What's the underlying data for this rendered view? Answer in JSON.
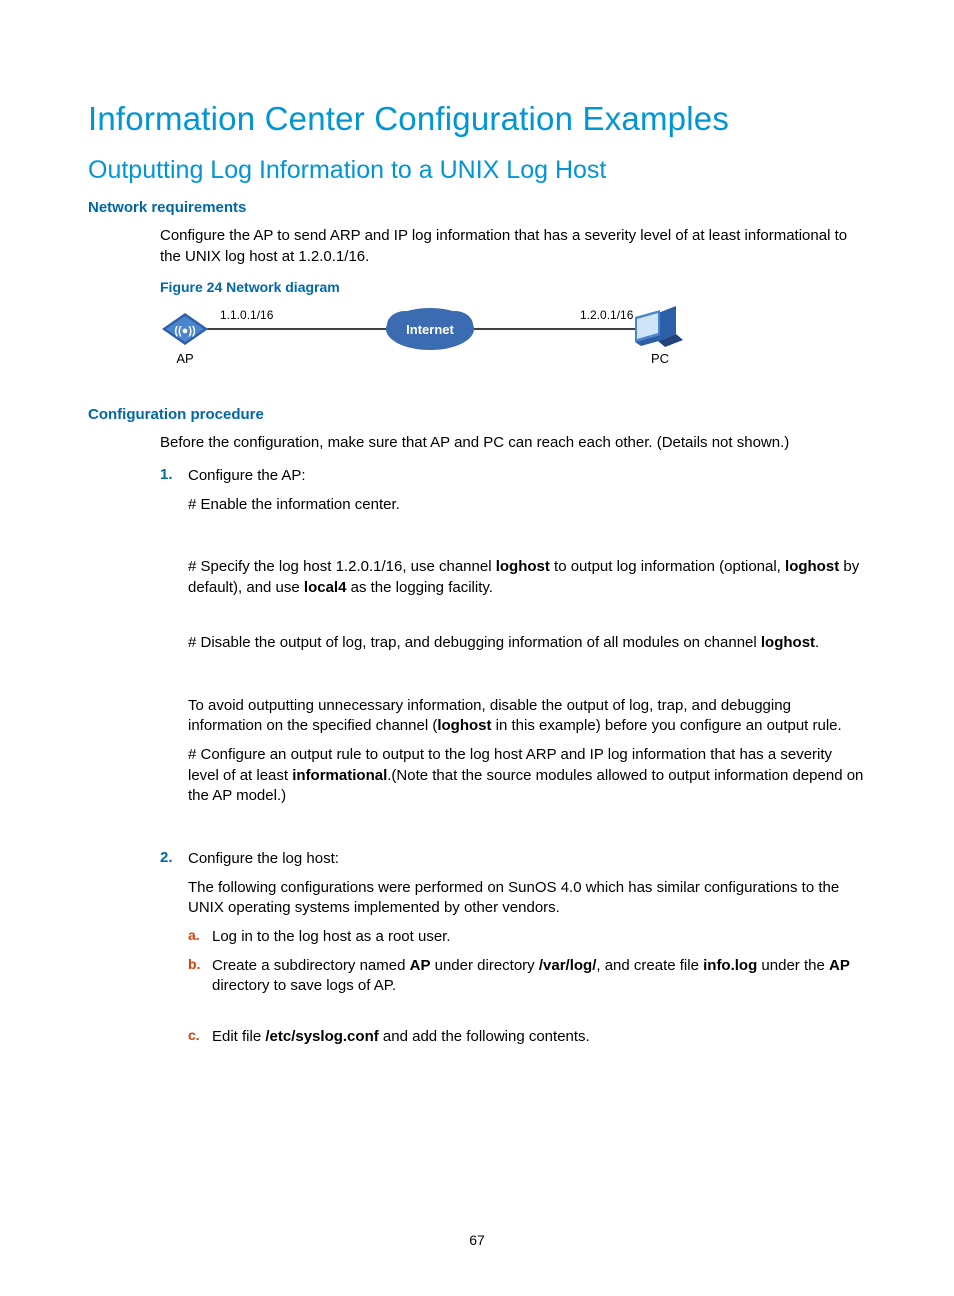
{
  "title": "Information Center Configuration Examples",
  "section": "Outputting Log Information to a UNIX Log Host",
  "sub1": "Network requirements",
  "req_p1": "Configure the AP to send ARP and IP log information that has a severity level of at least informational to the UNIX log host at 1.2.0.1/16.",
  "fig_caption": "Figure 24 Network diagram",
  "diagram": {
    "ap_ip": "1.1.0.1/16",
    "pc_ip": "1.2.0.1/16",
    "ap_label": "AP",
    "pc_label": "PC",
    "cloud_label": "Internet"
  },
  "sub2": "Configuration procedure",
  "pre_p": "Before the configuration, make sure that AP and PC can reach each other. (Details not shown.)",
  "step1": {
    "num": "1.",
    "title": "Configure the AP:",
    "l1": "# Enable the information center.",
    "l2a": "# Specify the log host 1.2.0.1/16, use channel ",
    "l2b": "loghost",
    "l2c": " to output log information (optional, ",
    "l2d": "loghost",
    "l2e": " by default), and use ",
    "l2f": "local4",
    "l2g": " as the logging facility.",
    "l3a": "# Disable the output of log, trap, and debugging information of all modules on channel ",
    "l3b": "loghost",
    "l3c": ".",
    "l4a": "To avoid outputting unnecessary information, disable the output of log, trap, and debugging information on the specified channel (",
    "l4b": "loghost",
    "l4c": " in this example) before you configure an output rule.",
    "l5a": "# Configure an output rule to output to the log host ARP and IP log information that has a severity level of at least ",
    "l5b": "informational",
    "l5c": ".(Note that the source modules allowed to output information depend on the AP model.)"
  },
  "step2": {
    "num": "2.",
    "title": "Configure the log host:",
    "p": "The following configurations were performed on SunOS 4.0 which has similar configurations to the UNIX operating systems implemented by other vendors.",
    "a": {
      "m": "a.",
      "t": "Log in to the log host as a root user."
    },
    "b": {
      "m": "b.",
      "t1": "Create a subdirectory named ",
      "t2": "AP",
      "t3": " under directory ",
      "t4": "/var/log/",
      "t5": ", and create file ",
      "t6": "info.log",
      "t7": " under the ",
      "t8": "AP",
      "t9": " directory to save logs of AP."
    },
    "c": {
      "m": "c.",
      "t1": "Edit file ",
      "t2": "/etc/syslog.conf",
      "t3": " and add the following contents."
    }
  },
  "page_number": "67"
}
